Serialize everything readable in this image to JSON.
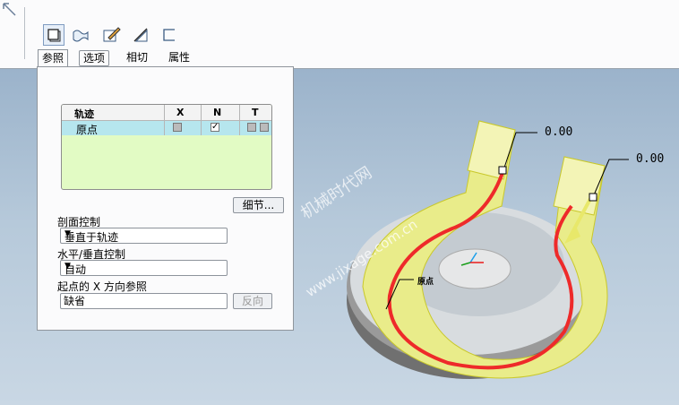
{
  "toolbar": {
    "icons": [
      "solid-icon",
      "surface-icon",
      "sketch-icon",
      "thin-icon",
      "remove-material-icon"
    ]
  },
  "tabs": [
    {
      "label": "参照"
    },
    {
      "label": "选项"
    },
    {
      "label": "相切"
    },
    {
      "label": "属性"
    }
  ],
  "trajectory_table": {
    "headers": {
      "name": "轨迹",
      "x": "X",
      "n": "N",
      "t": "T"
    },
    "rows": [
      {
        "name": "原点",
        "x": false,
        "n": true,
        "t": false
      }
    ]
  },
  "details_button": "细节...",
  "section_control": {
    "label": "剖面控制",
    "value": "垂直于轨迹"
  },
  "hv_control": {
    "label": "水平/垂直控制",
    "value": "自动"
  },
  "x_direction": {
    "label": "起点的 X 方向参照",
    "value": "缺省",
    "flip_button": "反向"
  },
  "model": {
    "dim_left": "0.00",
    "dim_right": "0.00",
    "origin_label": "原点",
    "trajectory_color": "#ee2a2a",
    "body_color": "#e9ec8a"
  },
  "watermark": {
    "line1": "机械时代网",
    "line2": "www.jixage.com.cn"
  }
}
